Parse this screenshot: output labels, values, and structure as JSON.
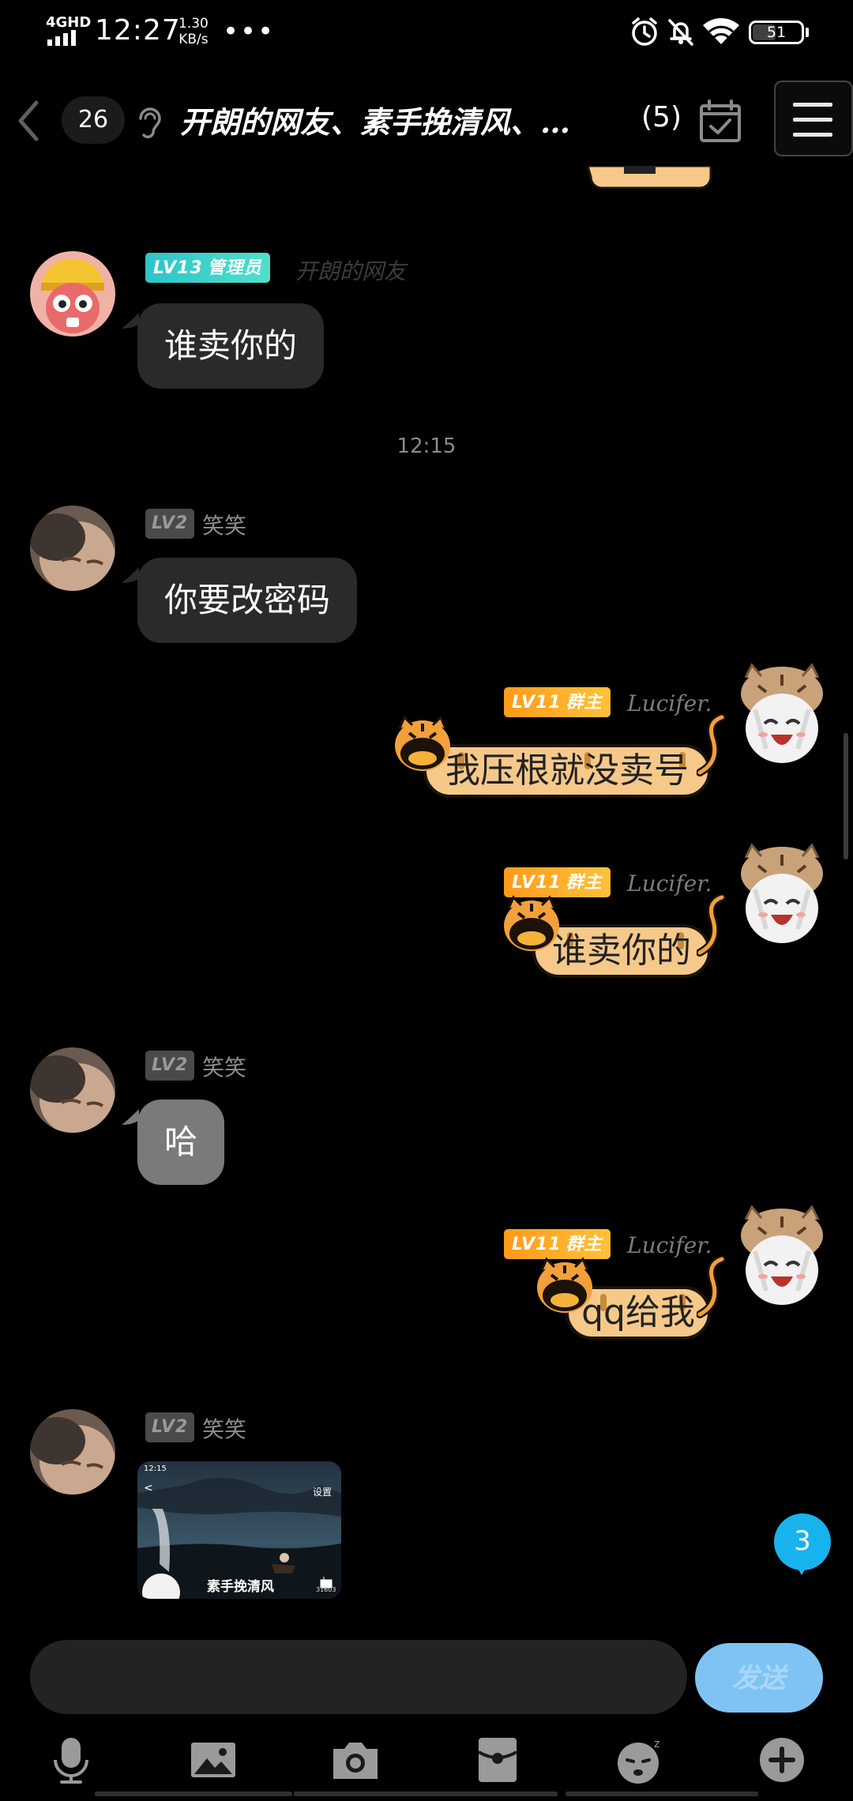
{
  "status_bar": {
    "network": "4GHD",
    "time": "12:27",
    "speed_value": "1.30",
    "speed_unit": "KB/s",
    "more": "•••",
    "battery": "51"
  },
  "header": {
    "unread_count": "26",
    "title": "开朗的网友、素手挽清风、…",
    "member_count": "(5)"
  },
  "messages": [
    {
      "badge_level": "LV13",
      "badge_role": "管理员",
      "sender": "开朗的网友",
      "text": "谁卖你的"
    },
    {
      "time": "12:15"
    },
    {
      "badge_level": "LV2",
      "sender": "笑笑",
      "text": "你要改密码"
    },
    {
      "badge_level": "LV11",
      "badge_role": "群主",
      "sender": "Lucifer.",
      "text": "我压根就没卖号"
    },
    {
      "badge_level": "LV11",
      "badge_role": "群主",
      "sender": "Lucifer.",
      "text": "谁卖你的"
    },
    {
      "badge_level": "LV2",
      "sender": "笑笑",
      "text": "哈"
    },
    {
      "badge_level": "LV11",
      "badge_role": "群主",
      "sender": "Lucifer.",
      "text": "qq给我"
    },
    {
      "badge_level": "LV2",
      "sender": "笑笑",
      "image": {
        "status_time": "12:15",
        "settings_label": "设置",
        "profile_name": "素手挽清风",
        "count": "31603"
      }
    }
  ],
  "new_message_badge": "3",
  "input": {
    "value": "",
    "placeholder": ""
  },
  "send_label": "发送",
  "toolbar": [
    "microphone-icon",
    "image-icon",
    "camera-icon",
    "red-packet-icon",
    "emoji-icon",
    "plus-icon"
  ],
  "colors": {
    "send": "#7fc3f4",
    "badge_admin": "#2ec4c9",
    "badge_owner": "#ffa726",
    "unread": "#18b3ec",
    "bubble": "#2a2a2a",
    "tiger_bubble": "#f6c98a"
  }
}
